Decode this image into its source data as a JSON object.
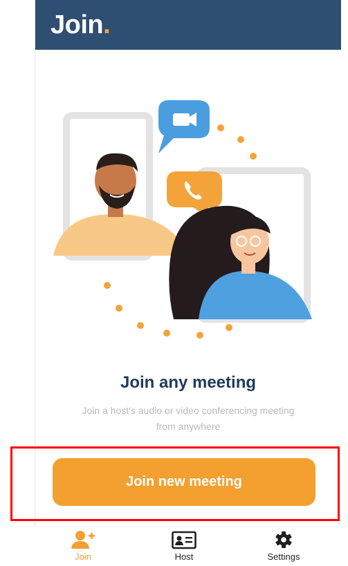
{
  "header": {
    "logo_text": "Join",
    "logo_dot": "."
  },
  "main": {
    "title": "Join any meeting",
    "subtitle": "Join a host's audio or video conferencing meeting from anywhere",
    "join_button_label": "Join new meeting"
  },
  "tabbar": {
    "items": [
      {
        "label": "Join",
        "icon": "add-user-icon",
        "active": true
      },
      {
        "label": "Host",
        "icon": "id-card-icon",
        "active": false
      },
      {
        "label": "Settings",
        "icon": "gear-icon",
        "active": false
      }
    ]
  },
  "colors": {
    "header_bg": "#2e4f72",
    "accent": "#f3a030",
    "title": "#1f3b5a",
    "subtitle": "#b9b9b9",
    "highlight_box": "#ff0000"
  }
}
